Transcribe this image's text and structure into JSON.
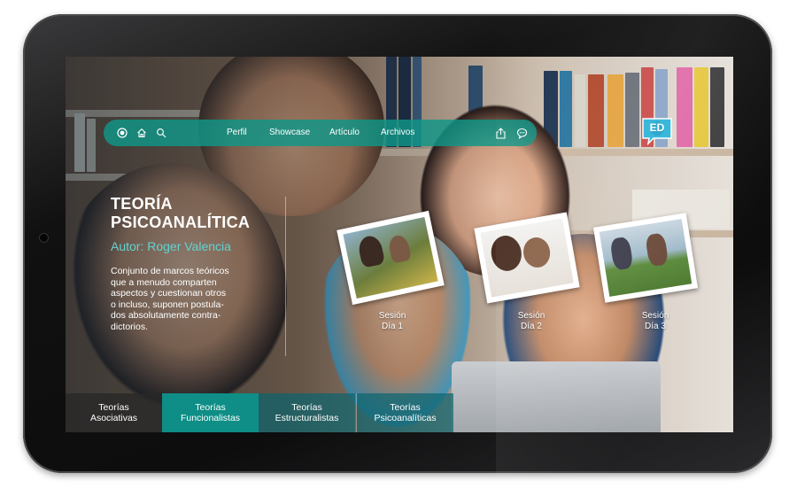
{
  "nav": {
    "links": [
      "Perfil",
      "Showcase",
      "Artículo",
      "Archivos"
    ],
    "icons": [
      "record-icon",
      "home-icon",
      "search-icon",
      "share-icon",
      "chat-icon"
    ]
  },
  "logo": {
    "text": "ED",
    "color": "#2bb3d8"
  },
  "content": {
    "title_line1": "TEORÍA",
    "title_line2": "PSICOANALÍTICA",
    "author": "Autor: Roger Valencia",
    "description_lines": [
      "Conjunto de marcos teóricos",
      "que a menudo comparten",
      "aspectos y cuestionan otros",
      "o incluso, suponen postula-",
      "dos absolutamente contra-",
      "dictorios."
    ]
  },
  "sessions": [
    {
      "line1": "Sesión",
      "line2": "Día 1"
    },
    {
      "line1": "Sesión",
      "line2": "Día 2"
    },
    {
      "line1": "Sesión",
      "line2": "Día 3"
    }
  ],
  "tabs": [
    {
      "line1": "Teorías",
      "line2": "Asociativas"
    },
    {
      "line1": "Teorías",
      "line2": "Funcionalistas"
    },
    {
      "line1": "Teorías",
      "line2": "Estructuralistas"
    },
    {
      "line1": "Teorías",
      "line2": "Psicoanalíticas"
    }
  ],
  "colors": {
    "accent": "#0e8e86",
    "author": "#62d3d0",
    "nav": "#0f9687"
  }
}
